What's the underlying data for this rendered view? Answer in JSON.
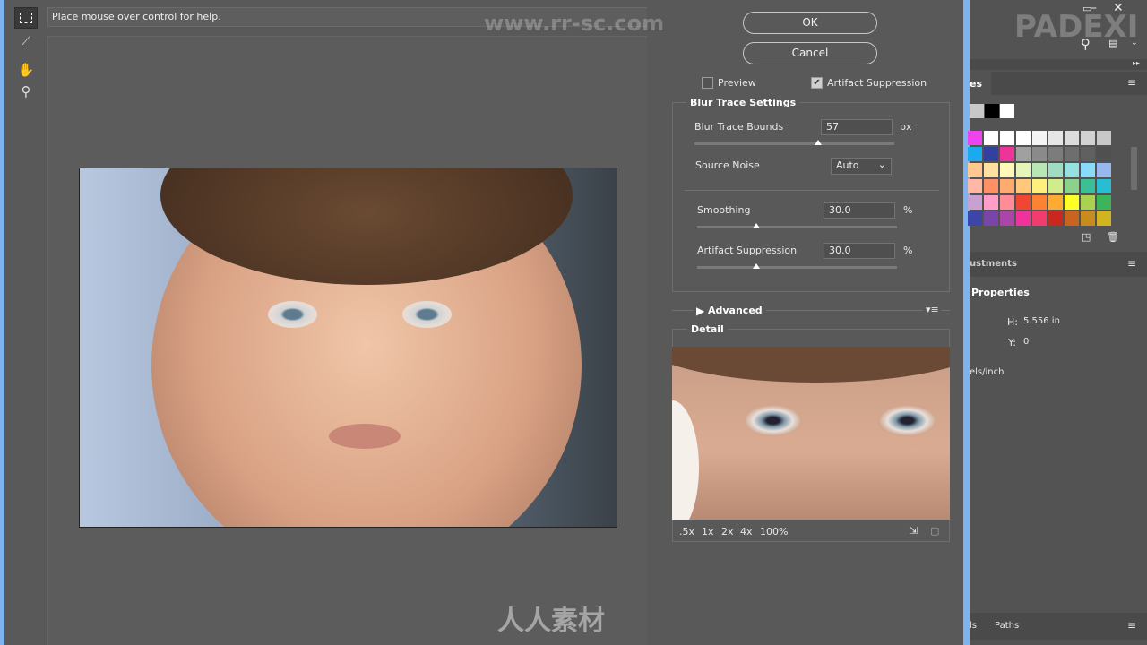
{
  "help_text": "Place mouse over control for help.",
  "tools": [
    {
      "icon": "marquee-icon"
    },
    {
      "icon": "blur-trace-icon"
    },
    {
      "icon": "hand-icon"
    },
    {
      "icon": "zoom-icon"
    }
  ],
  "dialog": {
    "ok": "OK",
    "cancel": "Cancel",
    "preview": {
      "label": "Preview",
      "checked": false
    },
    "artifact_suppression_check": {
      "label": "Artifact Suppression",
      "checked": true
    },
    "blur_trace": {
      "title": "Blur Trace Settings",
      "bounds": {
        "label": "Blur Trace Bounds",
        "value": "57",
        "unit": "px"
      },
      "source_noise": {
        "label": "Source Noise",
        "value": "Auto"
      },
      "smoothing": {
        "label": "Smoothing",
        "value": "30.0",
        "unit": "%"
      },
      "artifact": {
        "label": "Artifact Suppression",
        "value": "30.0",
        "unit": "%"
      }
    },
    "advanced": "Advanced",
    "detail": {
      "title": "Detail",
      "zooms": [
        ".5x",
        "1x",
        "2x",
        "4x",
        "100%"
      ]
    }
  },
  "ps_panel": {
    "tab_swatches": "es",
    "tab_adjustments": "ustments",
    "properties_title": "Properties",
    "h_label": "H:",
    "h_value": "5.556 in",
    "y_label": "Y:",
    "y_value": "0",
    "resolution_unit": "els/inch",
    "tab_channels": "ls",
    "tab_paths": "Paths",
    "swatches": [
      [
        "#ee44ee",
        "#ffffff",
        "#ffffff",
        "#ffffff",
        "#f4f4f4",
        "#e6e6e6",
        "#dcdcdc",
        "#d2d2d2",
        "#c8c8c8"
      ],
      [
        "#1aaaf0",
        "#3240a0",
        "#ee3399",
        "#a0a0a0",
        "#8a8a8a",
        "#7c7c7c",
        "#6e6e6e",
        "#606060",
        "#505050"
      ],
      [
        "#ffc891",
        "#ffe0a0",
        "#fff8b8",
        "#e4f5b8",
        "#b8e6b4",
        "#a0dcc0",
        "#96e0e0",
        "#88dcfa",
        "#96b8ee"
      ],
      [
        "#ffb8a8",
        "#ff9064",
        "#ffaa6e",
        "#ffc87a",
        "#fff07e",
        "#d2eb8c",
        "#8cd28c",
        "#3cbe96",
        "#28bed2"
      ],
      [
        "#c8a0d2",
        "#ff9ec8",
        "#ff8c96",
        "#f04632",
        "#ff8232",
        "#ffaa32",
        "#ffff28",
        "#aad250",
        "#3cb45a"
      ],
      [
        "#3c46aa",
        "#7846aa",
        "#aa46aa",
        "#f0329b",
        "#f03c6e",
        "#c8281e",
        "#c8641e",
        "#c88c1e",
        "#d2b41e"
      ]
    ]
  },
  "watermarks": {
    "top": "www.rr-sc.com",
    "corner": "PADEXI",
    "bottom": "人人素材"
  }
}
